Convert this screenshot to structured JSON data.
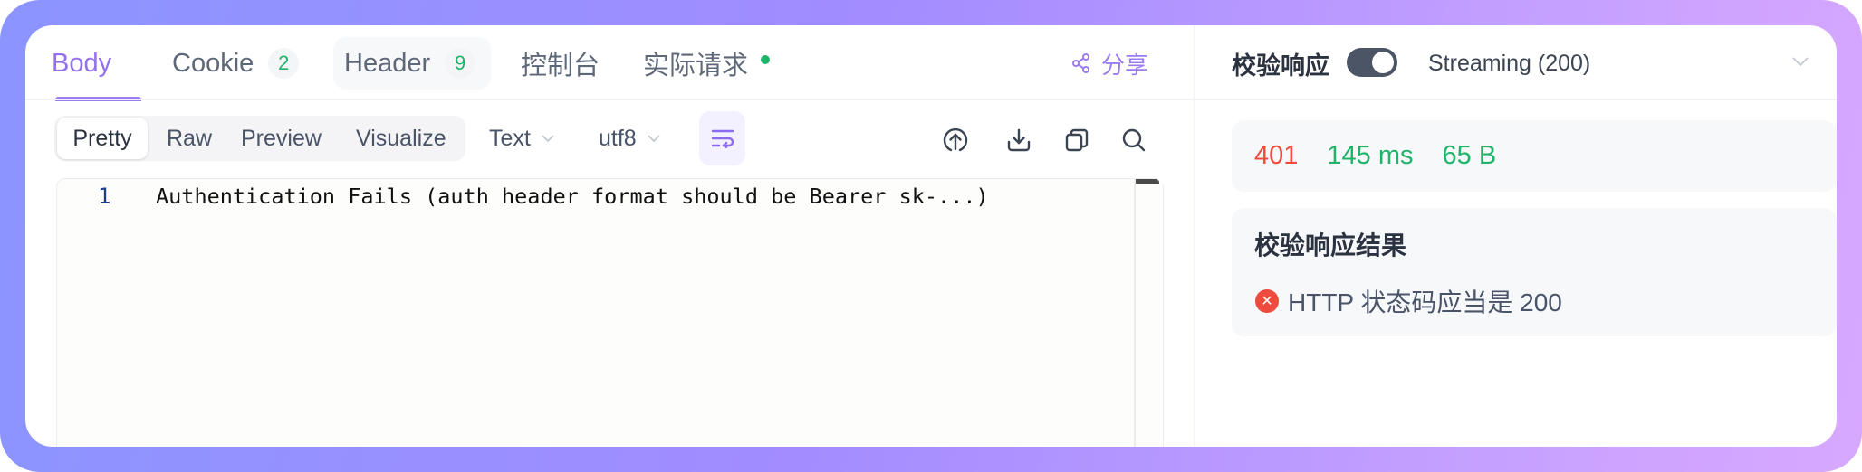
{
  "tabs": [
    {
      "label": "Body",
      "active": true
    },
    {
      "label": "Cookie",
      "badge": "2"
    },
    {
      "label": "Header",
      "badge": "9"
    },
    {
      "label": "控制台"
    },
    {
      "label": "实际请求",
      "dot": true
    }
  ],
  "share": {
    "label": "分享",
    "icon": "share-icon"
  },
  "toolbar": {
    "view_modes": [
      "Pretty",
      "Raw",
      "Preview",
      "Visualize"
    ],
    "active_view_mode": "Pretty",
    "format_select": "Text",
    "encoding_select": "utf8",
    "icons": [
      "wrap-lines-icon",
      "upload-icon",
      "download-icon",
      "copy-icon",
      "search-icon"
    ]
  },
  "editor": {
    "lines": [
      {
        "number": "1",
        "text": "Authentication Fails (auth header format should be Bearer sk-...)"
      }
    ]
  },
  "right_panel": {
    "validate_label": "校验响应",
    "validate_enabled": true,
    "streaming_label": "Streaming (200)",
    "status_code": "401",
    "time": "145 ms",
    "size": "65 B",
    "result_title": "校验响应结果",
    "results": [
      {
        "status": "fail",
        "text": "HTTP 状态码应当是 200"
      }
    ]
  },
  "colors": {
    "accent": "#9b7cf0",
    "success": "#22b36a",
    "error": "#ee4b3e"
  }
}
